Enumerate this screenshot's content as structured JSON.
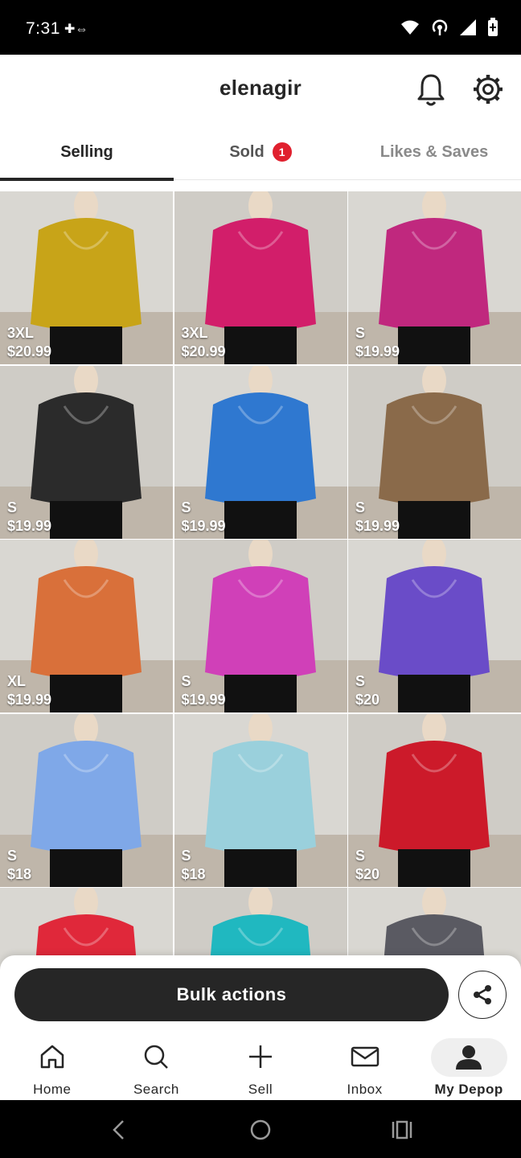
{
  "status_bar": {
    "time": "7:31",
    "extra": "✚⇔",
    "icons": [
      "wifi-icon",
      "hotspot-icon",
      "signal-icon",
      "battery-icon"
    ]
  },
  "header": {
    "title": "elenagir",
    "icons": [
      "bell-icon",
      "gear-icon"
    ]
  },
  "tabs": [
    {
      "label": "Selling",
      "active": true
    },
    {
      "label": "Sold",
      "badge": "1"
    },
    {
      "label": "Likes & Saves"
    }
  ],
  "listings": [
    {
      "size": "3XL",
      "price": "$20.99",
      "color": "#c8a418"
    },
    {
      "size": "3XL",
      "price": "$20.99",
      "color": "#d21e6a"
    },
    {
      "size": "S",
      "price": "$19.99",
      "color": "#c0287e"
    },
    {
      "size": "S",
      "price": "$19.99",
      "color": "#2b2b2b"
    },
    {
      "size": "S",
      "price": "$19.99",
      "color": "#2f78d0"
    },
    {
      "size": "S",
      "price": "$19.99",
      "color": "#8a6a4a"
    },
    {
      "size": "XL",
      "price": "$19.99",
      "color": "#d9703a"
    },
    {
      "size": "S",
      "price": "$19.99",
      "color": "#d040b8"
    },
    {
      "size": "S",
      "price": "$20",
      "color": "#6a4cc8"
    },
    {
      "size": "S",
      "price": "$18",
      "color": "#7fa8e8"
    },
    {
      "size": "S",
      "price": "$18",
      "color": "#9ad0dc"
    },
    {
      "size": "S",
      "price": "$20",
      "color": "#cc1a2a"
    },
    {
      "size": "",
      "price": "",
      "color": "#e0283a"
    },
    {
      "size": "",
      "price": "",
      "color": "#20b8c0"
    },
    {
      "size": "",
      "price": "",
      "color": "#5a5a62"
    }
  ],
  "bottom_sheet": {
    "bulk_label": "Bulk actions",
    "share_icon": "share-icon"
  },
  "nav": [
    {
      "label": "Home",
      "icon": "home-icon"
    },
    {
      "label": "Search",
      "icon": "search-icon"
    },
    {
      "label": "Sell",
      "icon": "plus-icon"
    },
    {
      "label": "Inbox",
      "icon": "mail-icon"
    },
    {
      "label": "My Depop",
      "icon": "profile-icon",
      "active": true
    }
  ],
  "system_nav": [
    "back-icon",
    "home-circle-icon",
    "recents-icon"
  ]
}
